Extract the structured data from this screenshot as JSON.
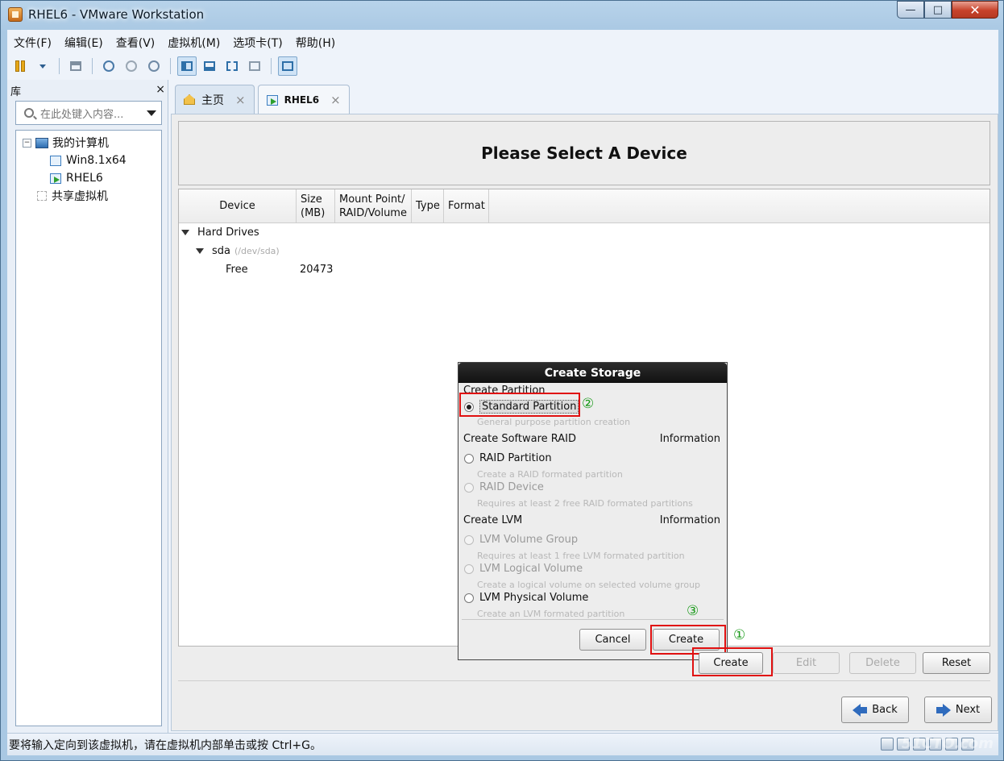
{
  "window": {
    "title": "RHEL6 - VMware Workstation",
    "minimize": "—",
    "maximize": "□",
    "close": "✕"
  },
  "menu": [
    "文件(F)",
    "编辑(E)",
    "查看(V)",
    "虚拟机(M)",
    "选项卡(T)",
    "帮助(H)"
  ],
  "library": {
    "header": "库",
    "close": "×",
    "search_placeholder": "在此处键入内容...",
    "tree": {
      "root": "我的计算机",
      "vm1": "Win8.1x64",
      "vm2": "RHEL6",
      "shared": "共享虚拟机"
    }
  },
  "tabs": {
    "home": "主页",
    "vm": "RHEL6",
    "close": "×"
  },
  "installer": {
    "heading": "Please Select A Device",
    "columns": {
      "device": "Device",
      "size_1": "Size",
      "size_2": "(MB)",
      "mount_1": "Mount Point/",
      "mount_2": "RAID/Volume",
      "type": "Type",
      "format": "Format"
    },
    "tree": {
      "hard_drives": "Hard Drives",
      "sda": "sda",
      "sda_path": "(/dev/sda)",
      "free": "Free",
      "free_size": "20473"
    },
    "buttons": {
      "create": "Create",
      "edit": "Edit",
      "delete": "Delete",
      "reset": "Reset",
      "back": "Back",
      "next": "Next"
    }
  },
  "dialog": {
    "title": "Create Storage",
    "create_partition": "Create Partition",
    "standard_partition": "Standard Partition",
    "standard_hint": "General purpose partition creation",
    "software_raid": "Create Software RAID",
    "information": "Information",
    "raid_partition": "RAID Partition",
    "raid_partition_hint": "Create a RAID formated partition",
    "raid_device": "RAID Device",
    "raid_device_hint": "Requires at least 2 free RAID formated partitions",
    "create_lvm": "Create LVM",
    "lvm_vg": "LVM Volume Group",
    "lvm_vg_hint": "Requires at least 1 free LVM formated partition",
    "lvm_lv": "LVM Logical Volume",
    "lvm_lv_hint": "Create a logical volume on selected volume group",
    "lvm_pv": "LVM Physical Volume",
    "lvm_pv_hint": "Create an LVM formated partition",
    "cancel": "Cancel",
    "create": "Create"
  },
  "markers": {
    "m1": "①",
    "m2": "②",
    "m3": "③"
  },
  "status": {
    "text": "要将输入定向到该虚拟机，请在虚拟机内部单击或按 Ctrl+G。",
    "watermark": "51CTO.com"
  },
  "colors": {
    "highlight_box": "#e01010",
    "marker_green": "#1a9a1a",
    "nav_arrow": "#2f6bbd"
  }
}
